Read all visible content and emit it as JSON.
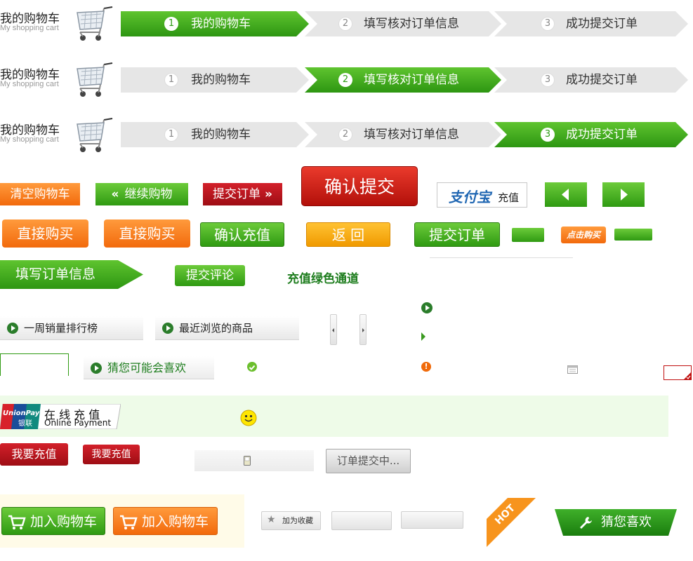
{
  "cart_header": {
    "title_zh": "我的购物车",
    "title_en": "My shopping cart"
  },
  "steps": [
    {
      "num": "1",
      "label": "我的购物车"
    },
    {
      "num": "2",
      "label": "填写核对订单信息"
    },
    {
      "num": "3",
      "label": "成功提交订单"
    }
  ],
  "buttons": {
    "clear_cart": "清空购物车",
    "continue_shopping": "继续购物",
    "submit_order": "提交订单",
    "confirm_submit": "确认提交",
    "alipay_logo": "支付宝",
    "recharge": "充值",
    "buy_now": "直接购买",
    "confirm_recharge": "确认充值",
    "back": "返  回",
    "submit_order_2": "提交订单",
    "click_buy": "点击购买",
    "fill_order_info": "填写订单信息",
    "submit_review": "提交评论",
    "green_channel": "充值绿色通道",
    "i_want_recharge": "我要充值",
    "submitting": "订单提交中...",
    "add_to_cart": "加入购物车",
    "add_favorite": "加为收藏",
    "hot": "HOT",
    "guess_you_like": "猜您喜欢"
  },
  "tabs": {
    "weekly_rank": "一周销量排行榜",
    "recent_viewed": "最近浏览的商品",
    "might_like": "猜您可能会喜欢"
  },
  "unionpay": {
    "logo_top": "UnionPay",
    "logo_bottom": "银联",
    "text_zh": "在 线 充 值",
    "text_en": "Online  Payment"
  },
  "colors": {
    "green": "#2f9a12",
    "red": "#c71e12",
    "orange": "#f26a0c",
    "dark_green_text": "#1e7d1e"
  }
}
